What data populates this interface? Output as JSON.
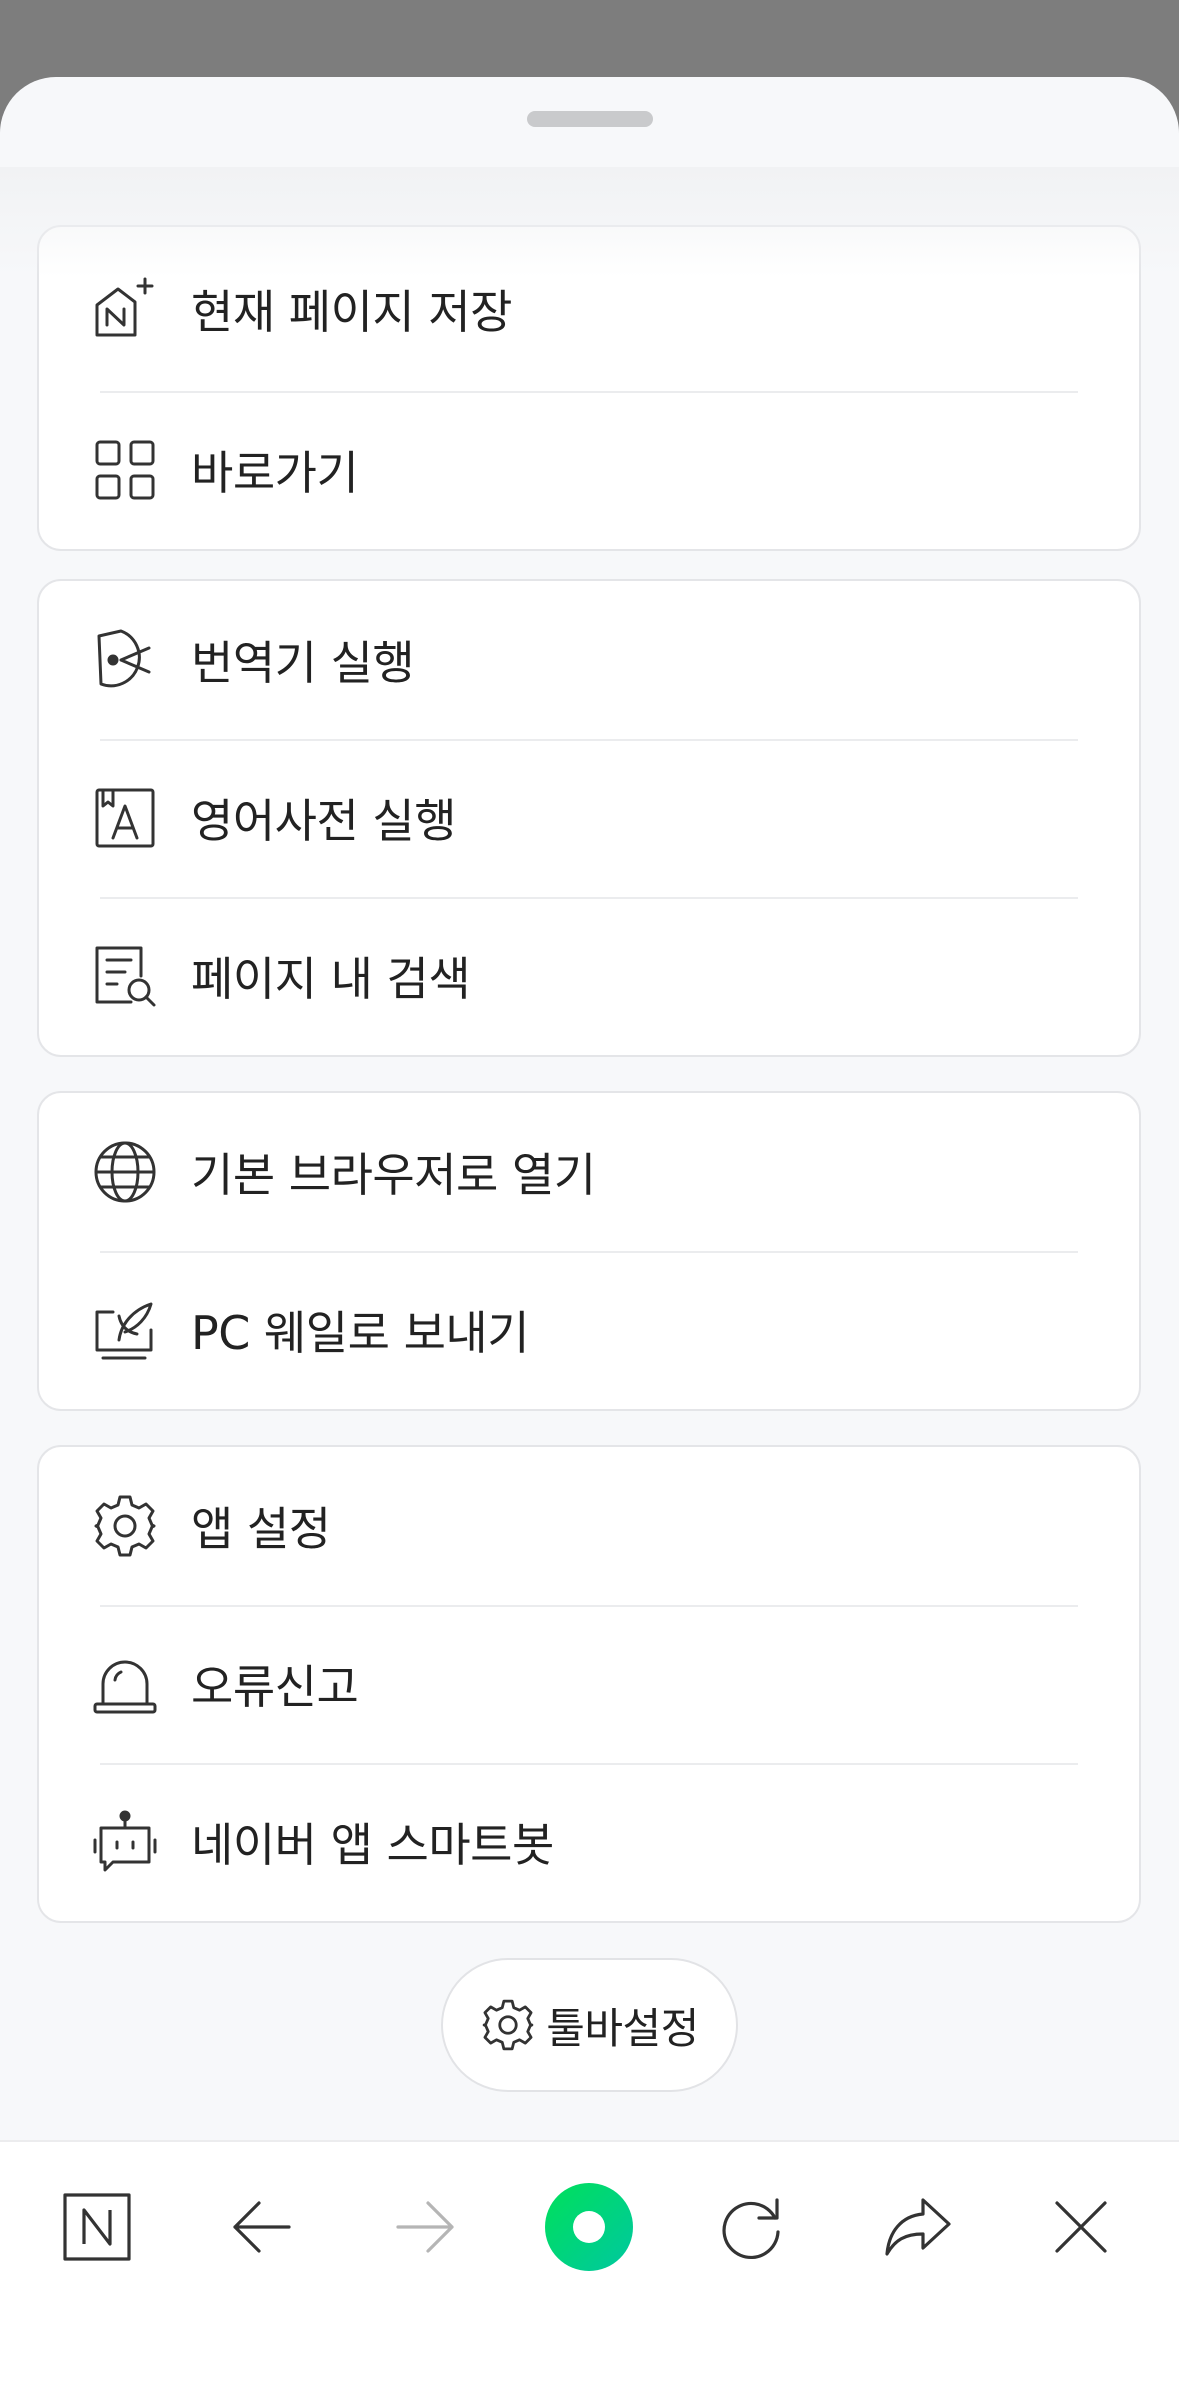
{
  "groups": [
    {
      "items": [
        {
          "label": "현재 페이지 저장",
          "icon": "save-page-icon"
        },
        {
          "label": "바로가기",
          "icon": "shortcut-grid-icon"
        }
      ]
    },
    {
      "items": [
        {
          "label": "번역기 실행",
          "icon": "translator-icon"
        },
        {
          "label": "영어사전 실행",
          "icon": "dictionary-icon"
        },
        {
          "label": "페이지 내 검색",
          "icon": "find-in-page-icon"
        }
      ]
    },
    {
      "items": [
        {
          "label": "기본 브라우저로 열기",
          "icon": "globe-icon"
        },
        {
          "label": "PC 웨일로 보내기",
          "icon": "send-to-pc-icon"
        }
      ]
    },
    {
      "items": [
        {
          "label": "앱 설정",
          "icon": "gear-icon"
        },
        {
          "label": "오류신고",
          "icon": "alarm-bell-icon"
        },
        {
          "label": "네이버 앱 스마트봇",
          "icon": "robot-icon"
        }
      ]
    }
  ],
  "toolbar_settings": {
    "label": "툴바설정",
    "icon": "gear-icon"
  },
  "bottom_toolbar": [
    {
      "icon": "naver-home-icon"
    },
    {
      "icon": "back-arrow-icon"
    },
    {
      "icon": "forward-arrow-icon",
      "disabled": true
    },
    {
      "icon": "green-dot-menu-icon"
    },
    {
      "icon": "refresh-icon"
    },
    {
      "icon": "share-icon"
    },
    {
      "icon": "close-icon"
    }
  ],
  "colors": {
    "accent_green": "#00d26a",
    "text": "#222222",
    "disabled": "#b5b5b5"
  }
}
